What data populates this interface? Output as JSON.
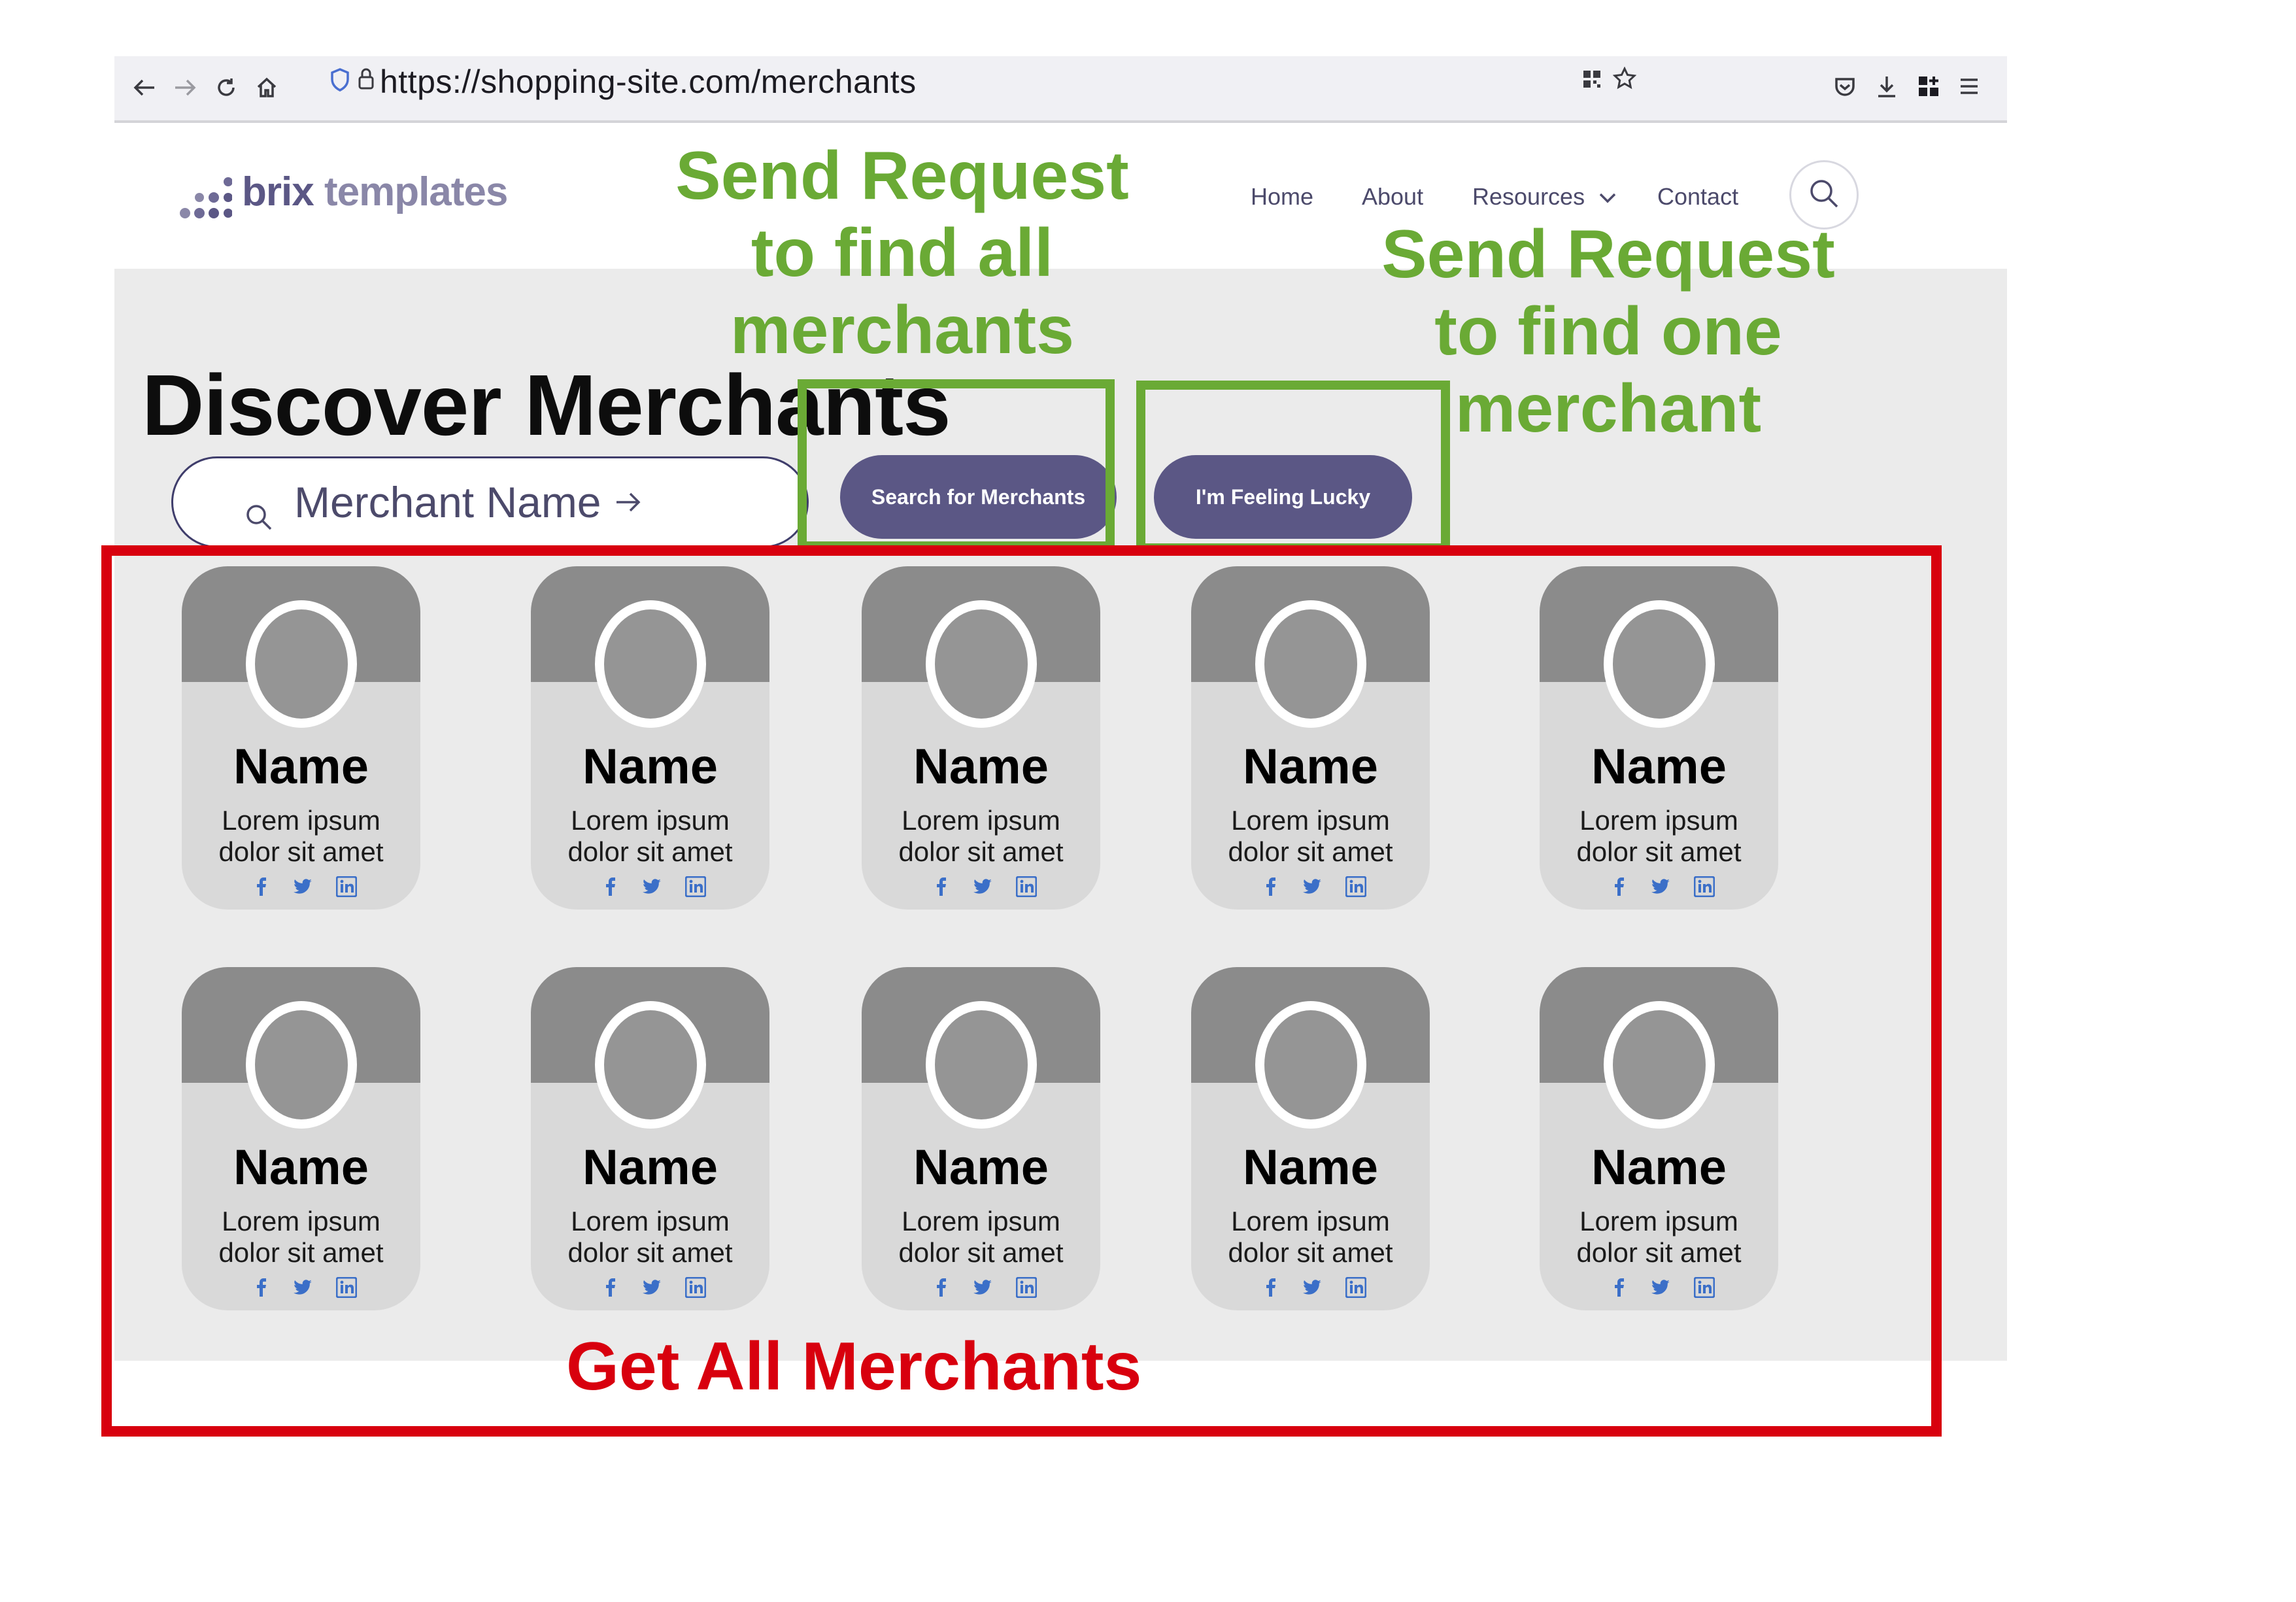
{
  "browser": {
    "url": "https://shopping-site.com/merchants",
    "icons": [
      "back-icon",
      "forward-icon",
      "reload-icon",
      "home-icon",
      "shield-icon",
      "lock-icon",
      "qr-icon",
      "star-icon",
      "pocket-icon",
      "download-icon",
      "extensions-icon",
      "menu-icon"
    ]
  },
  "header": {
    "logo_bold": "brix",
    "logo_light": "templates",
    "nav": [
      "Home",
      "About",
      "Resources",
      "Contact"
    ]
  },
  "hero": {
    "title": "Discover Merchants",
    "search_placeholder": "Merchant Name",
    "search_button": "Search for Merchants",
    "lucky_button": "I'm Feeling Lucky"
  },
  "merchants": [
    {
      "name": "Name",
      "line1": "Lorem ipsum",
      "line2": "dolor sit amet"
    },
    {
      "name": "Name",
      "line1": "Lorem ipsum",
      "line2": "dolor sit amet"
    },
    {
      "name": "Name",
      "line1": "Lorem ipsum",
      "line2": "dolor sit amet"
    },
    {
      "name": "Name",
      "line1": "Lorem ipsum",
      "line2": "dolor sit amet"
    },
    {
      "name": "Name",
      "line1": "Lorem ipsum",
      "line2": "dolor sit amet"
    },
    {
      "name": "Name",
      "line1": "Lorem ipsum",
      "line2": "dolor sit amet"
    },
    {
      "name": "Name",
      "line1": "Lorem ipsum",
      "line2": "dolor sit amet"
    },
    {
      "name": "Name",
      "line1": "Lorem ipsum",
      "line2": "dolor sit amet"
    },
    {
      "name": "Name",
      "line1": "Lorem ipsum",
      "line2": "dolor sit amet"
    },
    {
      "name": "Name",
      "line1": "Lorem ipsum",
      "line2": "dolor sit amet"
    }
  ],
  "annotations": {
    "search_all": [
      "Send Request",
      "to find all",
      "merchants"
    ],
    "find_one": [
      "Send Request",
      "to find one",
      "merchant"
    ],
    "get_all": "Get All Merchants"
  },
  "colors": {
    "accent": "#5b5785",
    "annotation_green": "#6aaa35",
    "annotation_red": "#d8000e",
    "social_blue": "#3b6fc8"
  }
}
